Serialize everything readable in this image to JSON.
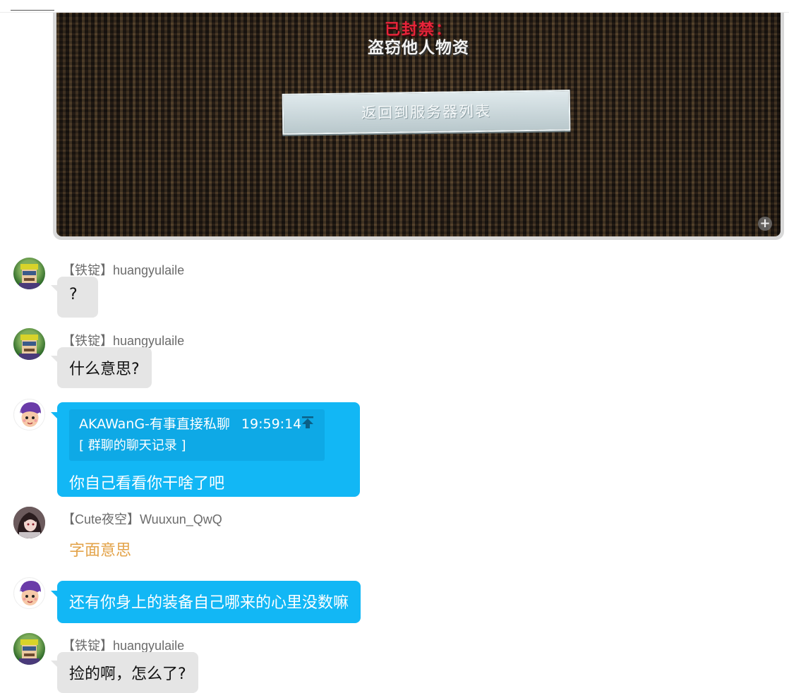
{
  "image_message": {
    "banned_title": "已封禁：",
    "ban_reason": "盗窃他人物资",
    "return_button": "返回到服务器列表"
  },
  "messages": [
    {
      "sender": "【铁锭】huangyulaile",
      "text": "?"
    },
    {
      "sender": "【铁锭】huangyulaile",
      "text": "什么意思?"
    },
    {
      "quote_author": "AKAWanG-有事直接私聊",
      "quote_time": "19:59:14",
      "quote_content": "[ 群聊的聊天记录 ]",
      "text": "你自己看看你干啥了吧"
    },
    {
      "sender": "【Cute夜空】Wuuxun_QwQ",
      "text": "字面意思"
    },
    {
      "text": "还有你身上的装备自己哪来的心里没数嘛"
    },
    {
      "sender": "【铁锭】huangyulaile",
      "text": "捡的啊，怎么了?"
    }
  ],
  "colors": {
    "blue_bubble": "#12b7f5",
    "gray_bubble": "#e5e5e5",
    "accent_text": "#e3a349"
  }
}
